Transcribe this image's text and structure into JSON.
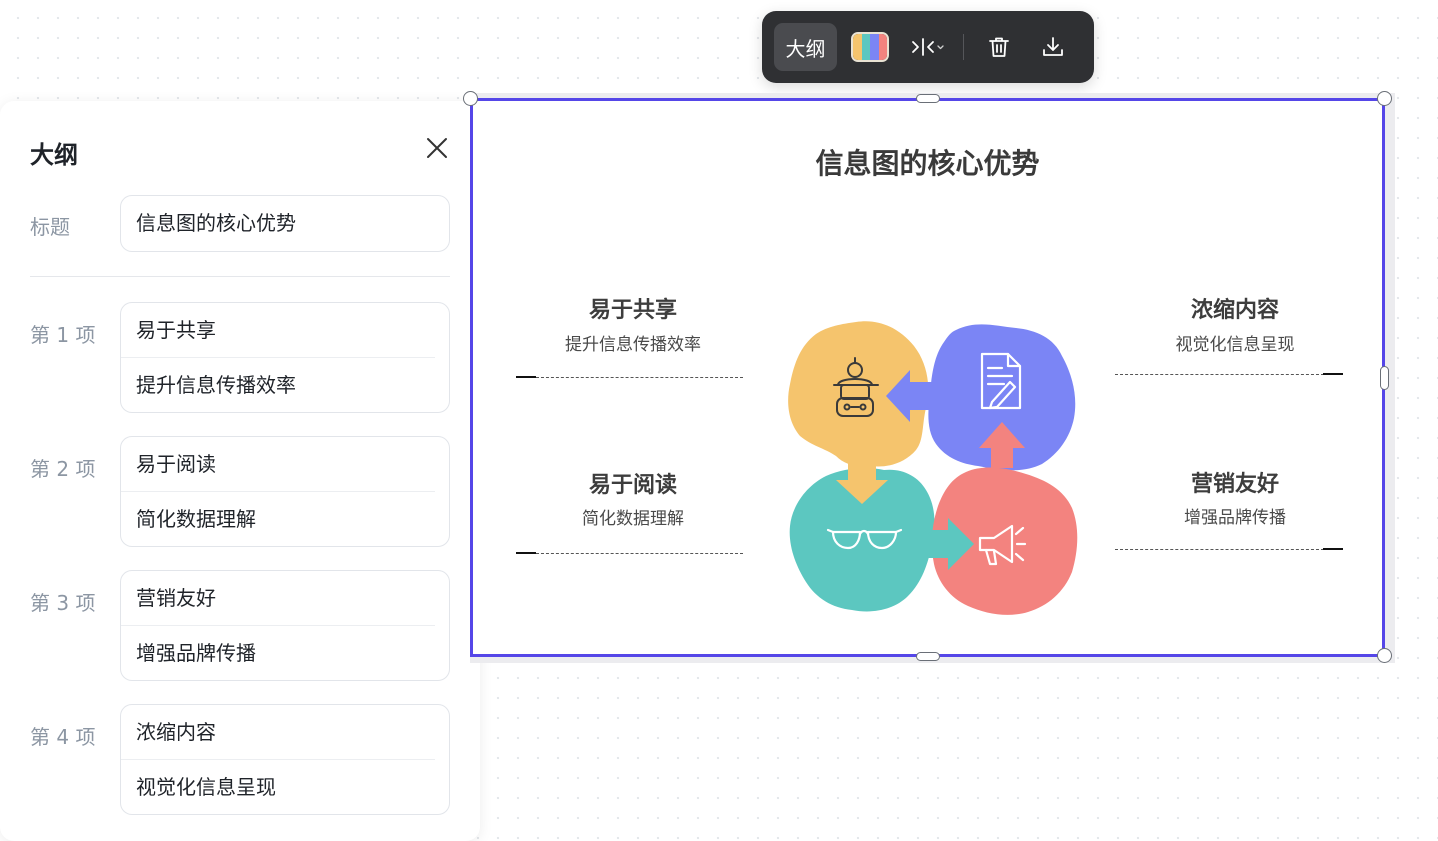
{
  "toolbar": {
    "outline_label": "大纲",
    "palette_colors": [
      "#f5c46d",
      "#5cc7c0",
      "#7b85f5",
      "#f3837f"
    ]
  },
  "panel": {
    "title": "大纲",
    "title_row_label": "标题",
    "title_value": "信息图的核心优势",
    "items": [
      {
        "label": "第 1 项",
        "title": "易于共享",
        "desc": "提升信息传播效率"
      },
      {
        "label": "第 2 项",
        "title": "易于阅读",
        "desc": "简化数据理解"
      },
      {
        "label": "第 3 项",
        "title": "营销友好",
        "desc": "增强品牌传播"
      },
      {
        "label": "第 4 项",
        "title": "浓缩内容",
        "desc": "视觉化信息呈现"
      }
    ]
  },
  "infographic": {
    "title": "信息图的核心优势",
    "colors": {
      "border": "#5546e8",
      "share": "#f5c46d",
      "read": "#5cc7c0",
      "marketing": "#f3837f",
      "condense": "#7b85f5"
    },
    "icons": [
      "robot-icon",
      "document-icon",
      "glasses-icon",
      "megaphone-icon"
    ]
  }
}
